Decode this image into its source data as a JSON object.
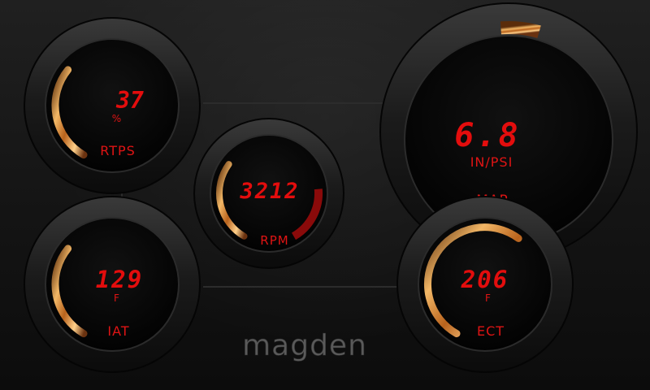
{
  "brand": "magden",
  "colors": {
    "readout": "#e30d0d",
    "arc": "#e8a040",
    "redline": "#8a0a0a",
    "bezel": "#1a1a1a"
  },
  "gauges": {
    "rtps": {
      "label": "RTPS",
      "value": "37",
      "unit": "%",
      "level": 0.33
    },
    "rpm": {
      "label": "RPM",
      "value": "3212",
      "unit": "",
      "level": 0.32
    },
    "map": {
      "label": "MAP",
      "value": "6.8",
      "unit": "IN/PSI",
      "level": 0.1
    },
    "iat": {
      "label": "IAT",
      "value": "129",
      "unit": "F",
      "level": 0.33
    },
    "ect": {
      "label": "ECT",
      "value": "206",
      "unit": "F",
      "level": 0.62
    }
  }
}
